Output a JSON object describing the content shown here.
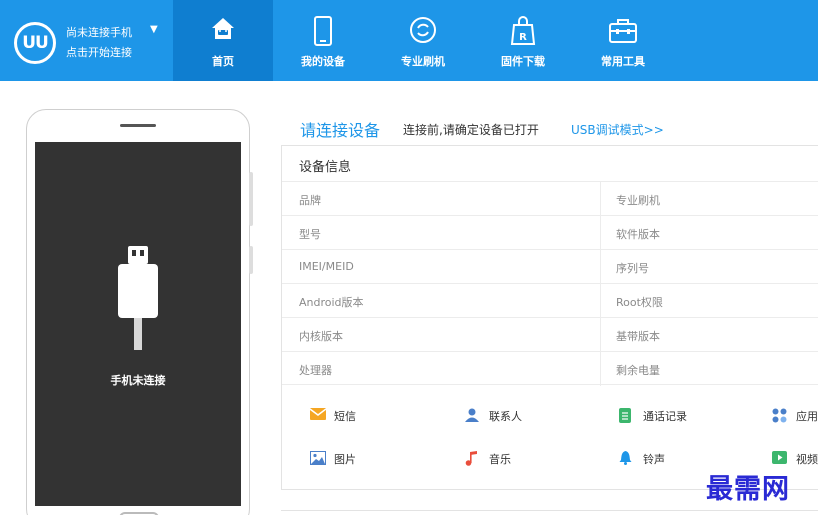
{
  "app": {
    "logo_text": "UU",
    "connection_title": "尚未连接手机",
    "connection_subtitle": "点击开始连接"
  },
  "nav": [
    {
      "label": "首页",
      "icon": "home-icon"
    },
    {
      "label": "我的设备",
      "icon": "phone-icon"
    },
    {
      "label": "专业刷机",
      "icon": "flash-icon"
    },
    {
      "label": "固件下载",
      "icon": "rom-bag-icon"
    },
    {
      "label": "常用工具",
      "icon": "toolbox-icon"
    }
  ],
  "phone": {
    "status": "手机未连接"
  },
  "connect": {
    "title": "请连接设备",
    "note": "连接前,请确定设备已打开",
    "link": "USB调试模式>>"
  },
  "device_info": {
    "title": "设备信息",
    "rows": [
      {
        "left": "品牌",
        "right": "专业刷机"
      },
      {
        "left": "型号",
        "right": "软件版本"
      },
      {
        "left": "IMEI/MEID",
        "right": "序列号"
      },
      {
        "left": "Android版本",
        "right": "Root权限"
      },
      {
        "left": "内核版本",
        "right": "基带版本"
      },
      {
        "left": "处理器",
        "right": "剩余电量"
      }
    ]
  },
  "quick_links": [
    {
      "label": "短信",
      "icon": "sms-icon"
    },
    {
      "label": "联系人",
      "icon": "contacts-icon"
    },
    {
      "label": "通话记录",
      "icon": "call-log-icon"
    },
    {
      "label": "应用",
      "icon": "apps-icon"
    },
    {
      "label": "图片",
      "icon": "picture-icon"
    },
    {
      "label": "音乐",
      "icon": "music-icon"
    },
    {
      "label": "铃声",
      "icon": "ringtone-icon"
    },
    {
      "label": "视频",
      "icon": "video-icon"
    }
  ],
  "colors": {
    "brand": "#1e96e8",
    "nav_active": "#0f7ed0",
    "phone_screen": "#333333"
  },
  "watermark": "最需网"
}
